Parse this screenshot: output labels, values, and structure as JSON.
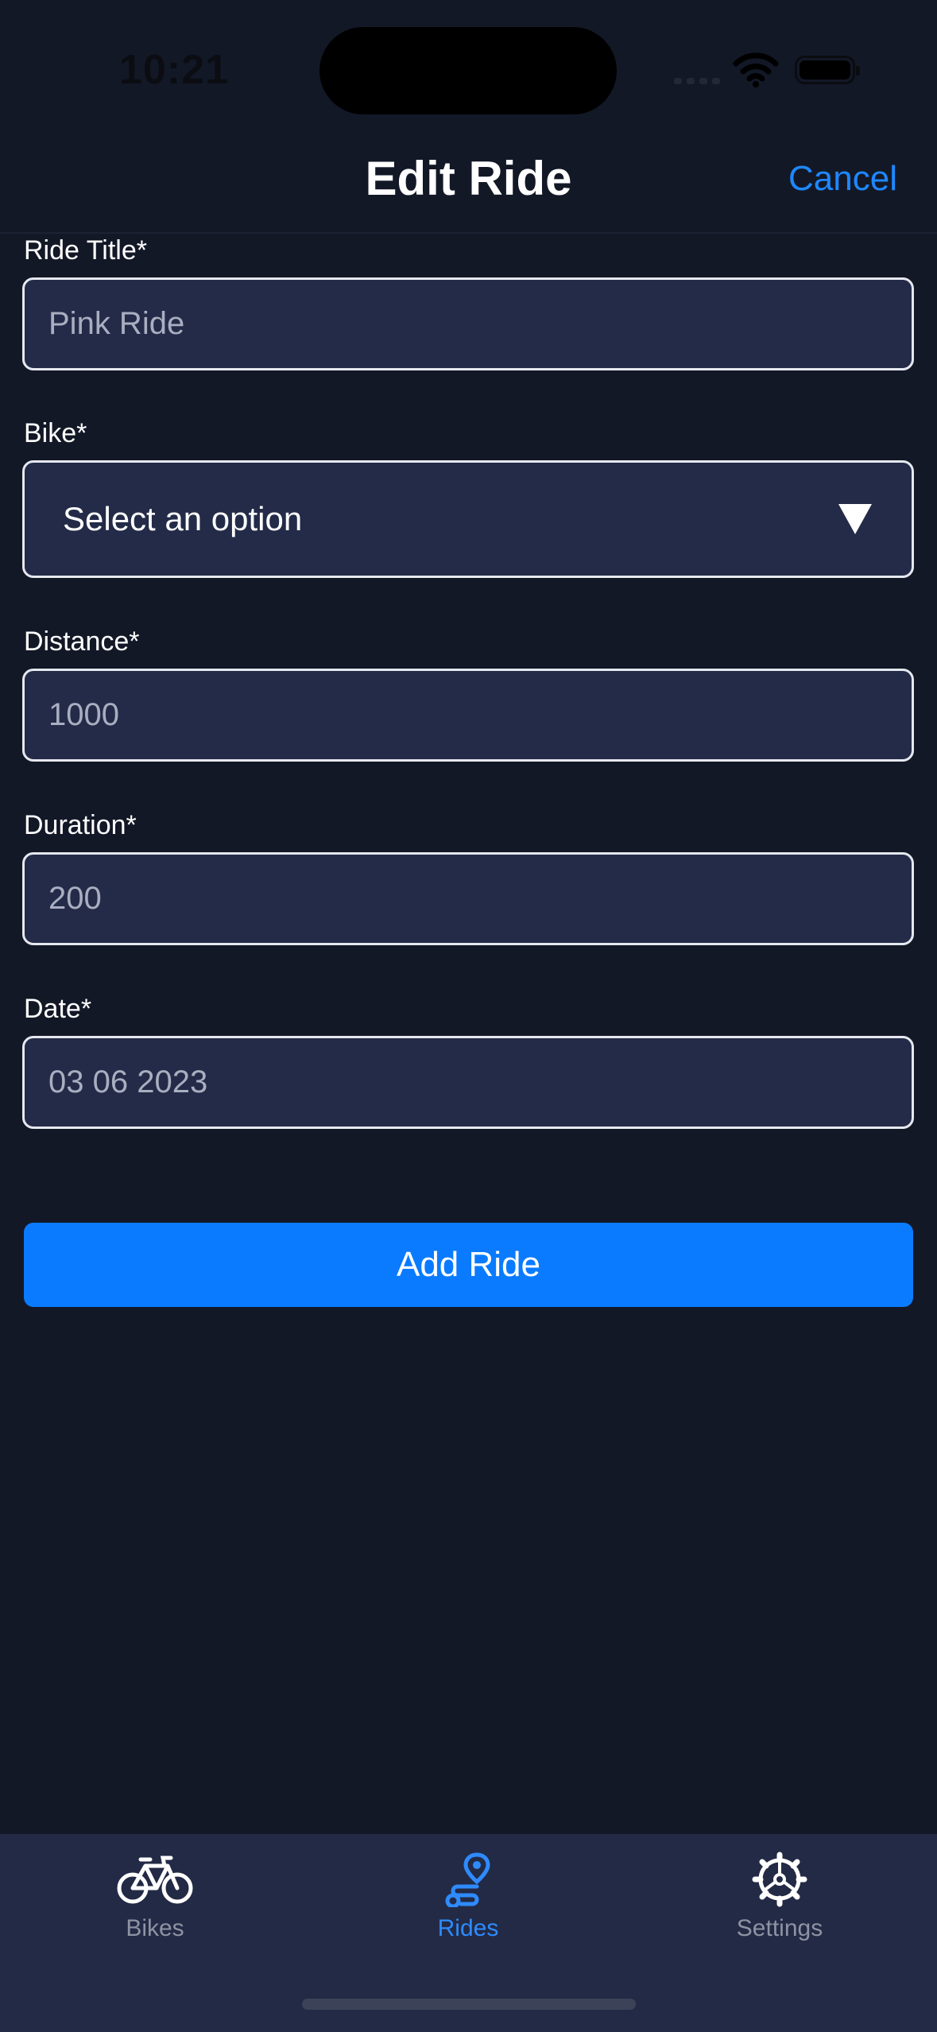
{
  "status_bar": {
    "time": "10:21"
  },
  "nav": {
    "title": "Edit Ride",
    "cancel_label": "Cancel"
  },
  "form": {
    "ride_title": {
      "label": "Ride Title*",
      "value": "Pink Ride"
    },
    "bike": {
      "label": "Bike*",
      "value": "Select an option"
    },
    "distance": {
      "label": "Distance*",
      "value": "1000"
    },
    "duration": {
      "label": "Duration*",
      "value": "200"
    },
    "date": {
      "label": "Date*",
      "value": "03 06 2023"
    },
    "submit_label": "Add Ride"
  },
  "tabs": [
    {
      "label": "Bikes",
      "icon": "bicycle-icon",
      "active": false
    },
    {
      "label": "Rides",
      "icon": "route-icon",
      "active": true
    },
    {
      "label": "Settings",
      "icon": "gear-icon",
      "active": false
    }
  ],
  "colors": {
    "background": "#131827",
    "field_background": "#232b48",
    "accent": "#0a7bff",
    "tab_bar": "#232a45",
    "inactive_tab": "#8e93a3"
  }
}
